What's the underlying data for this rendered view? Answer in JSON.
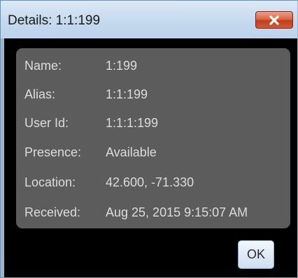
{
  "window": {
    "title": "Details: 1:1:199"
  },
  "details": [
    {
      "label": "Name:",
      "value": "1:199"
    },
    {
      "label": "Alias:",
      "value": "1:1:199"
    },
    {
      "label": "User Id:",
      "value": "1:1:1:199"
    },
    {
      "label": "Presence:",
      "value": "Available"
    },
    {
      "label": "Location:",
      "value": "42.600, -71.330"
    },
    {
      "label": "Received:",
      "value": "Aug 25, 2015 9:15:07 AM"
    }
  ],
  "buttons": {
    "ok_label": "OK",
    "close_icon": "close-icon"
  },
  "colors": {
    "title_bar": "#c7daee",
    "panel": "#5c5c5c",
    "background": "#000000",
    "text": "#dcdcdc",
    "close_button": "#d35a37"
  }
}
